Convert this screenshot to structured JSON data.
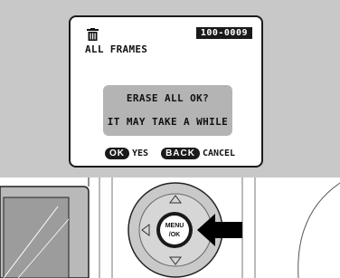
{
  "lcd": {
    "frame_counter": "100-0009",
    "title": "ALL FRAMES",
    "message_line1": "ERASE ALL OK?",
    "message_line2": "IT MAY TAKE A WHILE",
    "ok_key": "OK",
    "ok_action": "YES",
    "back_key": "BACK",
    "back_action": "CANCEL"
  },
  "camera": {
    "menu_button_line1": "MENU",
    "menu_button_line2": "/OK"
  },
  "colors": {
    "band": "#c8c8c8",
    "message_box": "#b4b4b4",
    "dark": "#1a1a1a"
  },
  "icons": [
    "trash-icon",
    "arrow-icon",
    "dpad-icon"
  ]
}
